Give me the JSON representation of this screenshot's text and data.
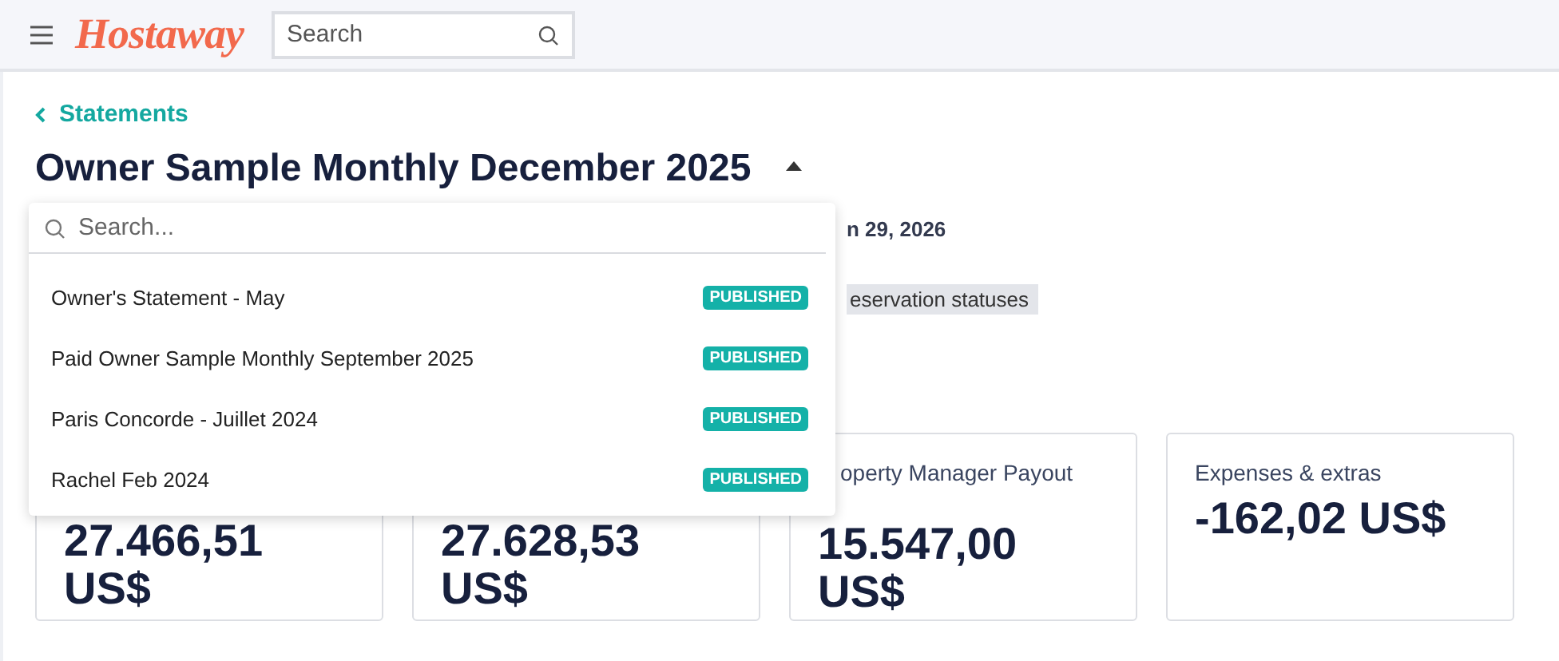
{
  "topbar": {
    "logo": "Hostaway",
    "search": {
      "placeholder": "Search"
    }
  },
  "breadcrumb": "Statements",
  "title": "Owner Sample Monthly December 2025",
  "date_fragment": "n 29, 2026",
  "tag_fragment": "eservation statuses",
  "dropdown": {
    "expanded": true,
    "search": {
      "placeholder": "Search..."
    },
    "items": [
      {
        "label": "Owner's Statement - May",
        "status": "PUBLISHED"
      },
      {
        "label": "Paid Owner Sample Monthly September 2025",
        "status": "PUBLISHED"
      },
      {
        "label": "Paris Concorde - Juillet 2024",
        "status": "PUBLISHED"
      },
      {
        "label": "Rachel Feb 2024",
        "status": "PUBLISHED"
      }
    ]
  },
  "cards": [
    {
      "value": "27.466,51 US$"
    },
    {
      "value": "27.628,53 US$"
    },
    {
      "label": "operty Manager Payout",
      "value": "15.547,00 US$"
    },
    {
      "label": "Expenses & extras",
      "value": "-162,02 US$"
    }
  ]
}
